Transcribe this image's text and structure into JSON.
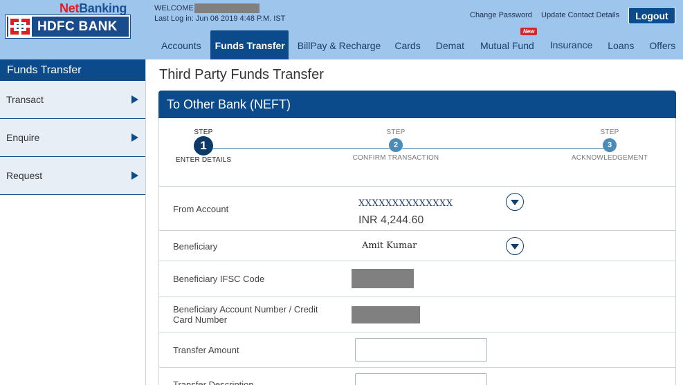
{
  "brand": {
    "net": "Net",
    "banking": "Banking",
    "bank_name": "HDFC BANK"
  },
  "welcome": {
    "label": "WELCOME",
    "last_login": "Last Log in: Jun 06 2019 4:48 P.M. IST"
  },
  "top_links": {
    "change_password": "Change Password",
    "update_contact": "Update Contact Details",
    "logout": "Logout"
  },
  "nav": {
    "items": [
      "Accounts",
      "Funds Transfer",
      "BillPay & Recharge",
      "Cards",
      "Demat",
      "Mutual Fund",
      "Insurance",
      "Loans",
      "Offers"
    ],
    "active": "Funds Transfer",
    "new_badge": "New"
  },
  "sidebar": {
    "title": "Funds Transfer",
    "items": [
      "Transact",
      "Enquire",
      "Request"
    ]
  },
  "main": {
    "page_title": "Third Party Funds Transfer",
    "panel_title": "To Other Bank (NEFT)"
  },
  "steps": [
    {
      "top": "STEP",
      "number": "1",
      "label": "ENTER DETAILS",
      "active": true
    },
    {
      "top": "STEP",
      "number": "2",
      "label": "CONFIRM TRANSACTION",
      "active": false
    },
    {
      "top": "STEP",
      "number": "3",
      "label": "ACKNOWLEDGEMENT",
      "active": false
    }
  ],
  "form": {
    "from_account_label": "From Account",
    "from_account_value": "XXXXXXXXXXXXXX",
    "from_account_balance": "INR 4,244.60",
    "beneficiary_label": "Beneficiary",
    "beneficiary_value": "Amit Kumar",
    "ifsc_label": "Beneficiary IFSC Code",
    "account_number_label": "Beneficiary Account Number / Credit Card Number",
    "amount_label": "Transfer Amount",
    "description_label": "Transfer Description"
  },
  "colors": {
    "header_bg": "#9ec6ed",
    "primary": "#0b4a8b",
    "accent_red": "#e31b23"
  }
}
